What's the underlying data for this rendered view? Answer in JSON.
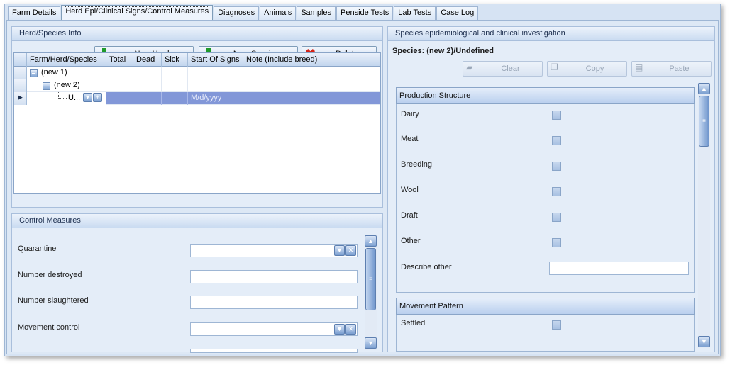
{
  "tabs": [
    {
      "label": "Farm Details"
    },
    {
      "label": "Herd Epi/Clinical Signs/Control Measures"
    },
    {
      "label": "Diagnoses"
    },
    {
      "label": "Animals"
    },
    {
      "label": "Samples"
    },
    {
      "label": "Penside Tests"
    },
    {
      "label": "Lab Tests"
    },
    {
      "label": "Case Log"
    }
  ],
  "herd_species": {
    "title": "Herd/Species Info",
    "new_herd": "New Herd",
    "new_species": "New Species",
    "delete": "Delete",
    "columns": [
      "Farm/Herd/Species",
      "Total",
      "Dead",
      "Sick",
      "Start Of Signs",
      "Note (Include breed)"
    ],
    "rows": [
      {
        "label": "(new 1)"
      },
      {
        "label": "(new 2)"
      },
      {
        "label": "U...",
        "start_of_signs": "M/d/yyyy"
      }
    ]
  },
  "control_measures": {
    "title": "Control Measures",
    "quarantine": "Quarantine",
    "number_destroyed": "Number destroyed",
    "number_slaughtered": "Number slaughtered",
    "movement_control": "Movement control"
  },
  "species_panel": {
    "title": "Species epidemiological and clinical investigation",
    "species_line": "Species:  (new 2)/Undefined",
    "clear": "Clear",
    "copy": "Copy",
    "paste": "Paste"
  },
  "production_structure": {
    "title": "Production Structure",
    "items": [
      "Dairy",
      "Meat",
      "Breeding",
      "Wool",
      "Draft",
      "Other"
    ],
    "describe_other": "Describe other"
  },
  "movement_pattern": {
    "title": "Movement Pattern",
    "items": [
      "Settled"
    ]
  },
  "colors": {
    "accent": "#8297d8",
    "panel_bg": "#e4edf8",
    "border": "#9eb6d4"
  }
}
